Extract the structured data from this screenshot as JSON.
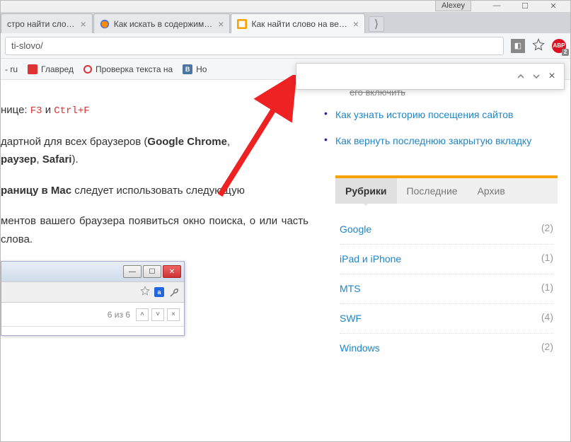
{
  "titlebar": {
    "user": "Alexey"
  },
  "tabs": [
    {
      "title": "стро найти сло…"
    },
    {
      "title": "Как искать в содержим…"
    },
    {
      "title": "Как найти слово на ве…"
    }
  ],
  "url": "ti-slovo/",
  "bookmarks": {
    "b0": "- ru",
    "b1": "Главред",
    "b2": "Проверка текста на",
    "b3": "Но"
  },
  "find": {
    "placeholder": ""
  },
  "article": {
    "p1a": "нице: ",
    "p1b": "F3",
    "p1c": " и ",
    "p1d": "Ctrl+F",
    "p2a": "дартной для всех браузеров (",
    "p2b": "Google Chrome",
    "p2c": ", ",
    "p2d": "раузер",
    "p2e": ", ",
    "p2f": "Safari",
    "p2g": ").",
    "p3a": "раницу в Mac",
    "p3b": " следует использовать следующую",
    "p4": "ментов вашего браузера появиться окно поиска, о или часть слова."
  },
  "inset": {
    "count": "6 из 6"
  },
  "sidebar": {
    "cut": "его включить",
    "links": [
      "Как узнать историю посещения сайтов",
      "Как вернуть последнюю закрытую вкладку"
    ],
    "tabs": {
      "t0": "Рубрики",
      "t1": "Последние",
      "t2": "Архив"
    },
    "cats": [
      {
        "name": "Google",
        "count": "(2)"
      },
      {
        "name": "iPad и iPhone",
        "count": "(1)"
      },
      {
        "name": "MTS",
        "count": "(1)"
      },
      {
        "name": "SWF",
        "count": "(4)"
      },
      {
        "name": "Windows",
        "count": "(2)"
      }
    ]
  }
}
